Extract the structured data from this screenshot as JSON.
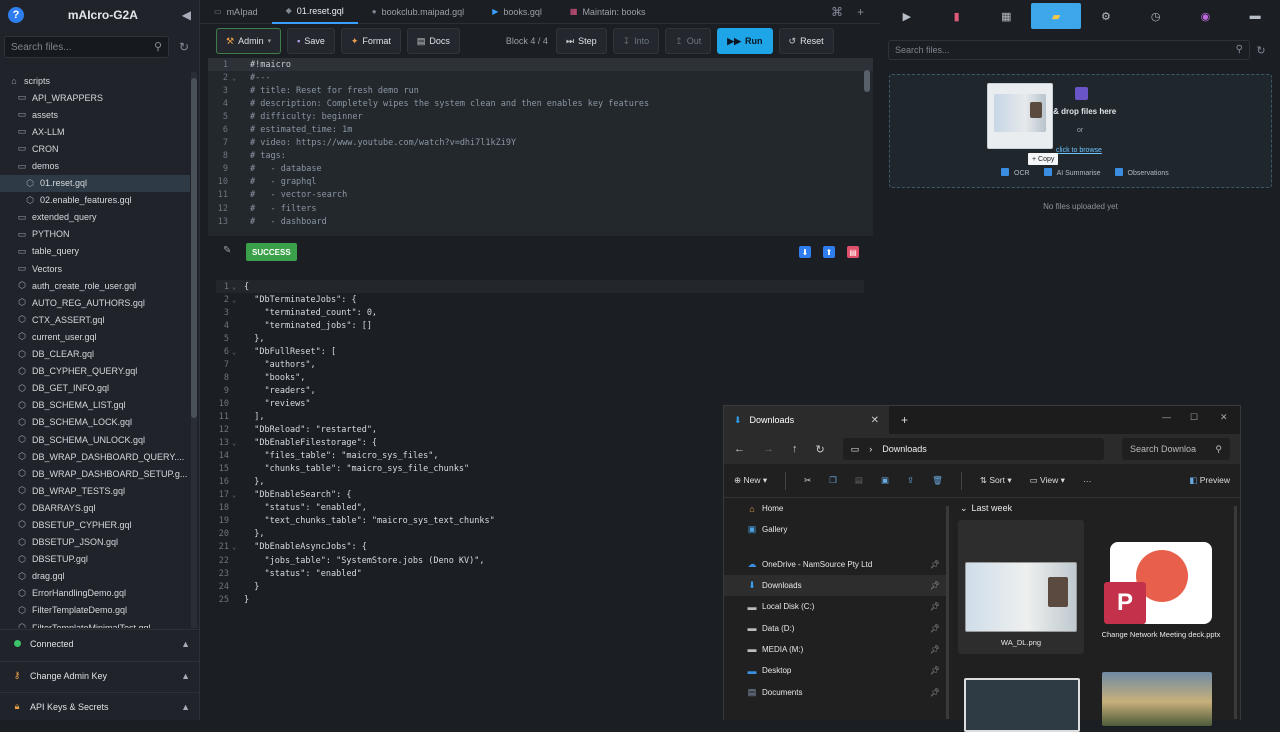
{
  "sidebar": {
    "title": "mAIcro-G2A",
    "search_placeholder": "Search files...",
    "tree": [
      {
        "label": "scripts",
        "icon": "folder",
        "indent": 0
      },
      {
        "label": "API_WRAPPERS",
        "icon": "folder",
        "indent": 1
      },
      {
        "label": "assets",
        "icon": "folder",
        "indent": 1
      },
      {
        "label": "AX-LLM",
        "icon": "folder",
        "indent": 1
      },
      {
        "label": "CRON",
        "icon": "folder",
        "indent": 1
      },
      {
        "label": "demos",
        "icon": "folder",
        "indent": 1
      },
      {
        "label": "01.reset.gql",
        "icon": "graphql",
        "indent": 2,
        "selected": true
      },
      {
        "label": "02.enable_features.gql",
        "icon": "graphql",
        "indent": 2
      },
      {
        "label": "extended_query",
        "icon": "folder",
        "indent": 1
      },
      {
        "label": "PYTHON",
        "icon": "folder",
        "indent": 1
      },
      {
        "label": "table_query",
        "icon": "folder",
        "indent": 1
      },
      {
        "label": "Vectors",
        "icon": "folder",
        "indent": 1
      },
      {
        "label": "auth_create_role_user.gql",
        "icon": "graphql",
        "indent": 1
      },
      {
        "label": "AUTO_REG_AUTHORS.gql",
        "icon": "graphql",
        "indent": 1
      },
      {
        "label": "CTX_ASSERT.gql",
        "icon": "graphql",
        "indent": 1
      },
      {
        "label": "current_user.gql",
        "icon": "graphql",
        "indent": 1
      },
      {
        "label": "DB_CLEAR.gql",
        "icon": "graphql",
        "indent": 1
      },
      {
        "label": "DB_CYPHER_QUERY.gql",
        "icon": "graphql",
        "indent": 1
      },
      {
        "label": "DB_GET_INFO.gql",
        "icon": "graphql",
        "indent": 1
      },
      {
        "label": "DB_SCHEMA_LIST.gql",
        "icon": "graphql",
        "indent": 1
      },
      {
        "label": "DB_SCHEMA_LOCK.gql",
        "icon": "graphql",
        "indent": 1
      },
      {
        "label": "DB_SCHEMA_UNLOCK.gql",
        "icon": "graphql",
        "indent": 1
      },
      {
        "label": "DB_WRAP_DASHBOARD_QUERY....",
        "icon": "graphql",
        "indent": 1
      },
      {
        "label": "DB_WRAP_DASHBOARD_SETUP.g...",
        "icon": "graphql",
        "indent": 1
      },
      {
        "label": "DB_WRAP_TESTS.gql",
        "icon": "graphql",
        "indent": 1
      },
      {
        "label": "DBARRAYS.gql",
        "icon": "graphql",
        "indent": 1
      },
      {
        "label": "DBSETUP_CYPHER.gql",
        "icon": "graphql",
        "indent": 1
      },
      {
        "label": "DBSETUP_JSON.gql",
        "icon": "graphql",
        "indent": 1
      },
      {
        "label": "DBSETUP.gql",
        "icon": "graphql",
        "indent": 1
      },
      {
        "label": "drag.gql",
        "icon": "graphql",
        "indent": 1
      },
      {
        "label": "ErrorHandlingDemo.gql",
        "icon": "graphql",
        "indent": 1
      },
      {
        "label": "FilterTemplateDemo.gql",
        "icon": "graphql",
        "indent": 1
      },
      {
        "label": "FilterTemplateMinimalTest.gql",
        "icon": "graphql",
        "indent": 1
      }
    ],
    "footer": {
      "connected": "Connected",
      "admin_key": "Change Admin Key",
      "api_keys": "API Keys & Secrets"
    }
  },
  "tabs": [
    {
      "label": "mAIpad",
      "icon": "pad"
    },
    {
      "label": "01.reset.gql",
      "icon": "graphql",
      "active": true
    },
    {
      "label": "bookclub.maipad.gql",
      "icon": "dot"
    },
    {
      "label": "books.gql",
      "icon": "play"
    },
    {
      "label": "Maintain: books",
      "icon": "grid"
    }
  ],
  "toolbar": {
    "admin": "Admin",
    "save": "Save",
    "format": "Format",
    "docs": "Docs",
    "block": "Block 4 / 4",
    "step": "Step",
    "into": "Into",
    "out": "Out",
    "run": "Run",
    "reset": "Reset"
  },
  "code_lines": [
    "#!maicro",
    "#---",
    "# title: Reset for fresh demo run",
    "# description: Completely wipes the system clean and then enables key features",
    "# difficulty: beginner",
    "# estimated_time: 1m",
    "# video: https://www.youtube.com/watch?v=dhi7l1kZi9Y",
    "# tags:",
    "#   - database",
    "#   - graphql",
    "#   - vector-search",
    "#   - filters",
    "#   - dashboard"
  ],
  "result": {
    "status": "SUCCESS"
  },
  "json_lines": [
    "{",
    "  \"DbTerminateJobs\": {",
    "    \"terminated_count\": 0,",
    "    \"terminated_jobs\": []",
    "  },",
    "  \"DbFullReset\": [",
    "    \"authors\",",
    "    \"books\",",
    "    \"readers\",",
    "    \"reviews\"",
    "  ],",
    "  \"DbReload\": \"restarted\",",
    "  \"DbEnableFilestorage\": {",
    "    \"files_table\": \"maicro_sys_files\",",
    "    \"chunks_table\": \"maicro_sys_file_chunks\"",
    "  },",
    "  \"DbEnableSearch\": {",
    "    \"status\": \"enabled\",",
    "    \"text_chunks_table\": \"maicro_sys_text_chunks\"",
    "  },",
    "  \"DbEnableAsyncJobs\": {",
    "    \"jobs_table\": \"SystemStore.jobs (Deno KV)\",",
    "    \"status\": \"enabled\"",
    "  }",
    "}"
  ],
  "right_panel": {
    "search_placeholder": "Search files...",
    "drop_text": "g & drop files here",
    "or": "or",
    "browse": "click to browse",
    "copy_tip": "+ Copy",
    "options": [
      "OCR",
      "AI Summarise",
      "Observations"
    ],
    "no_files": "No files uploaded yet"
  },
  "explorer": {
    "tab_title": "Downloads",
    "path": "Downloads",
    "search": "Search Downloa",
    "cmd": {
      "new": "New",
      "sort": "Sort",
      "view": "View",
      "preview": "Preview"
    },
    "nav": [
      {
        "label": "Home",
        "icon": "home"
      },
      {
        "label": "Gallery",
        "icon": "gallery"
      },
      {
        "label": "OneDrive - NamSource Pty Ltd",
        "icon": "cloud",
        "pin": true
      },
      {
        "label": "Downloads",
        "icon": "download",
        "pin": true,
        "selected": true
      },
      {
        "label": "Local Disk (C:)",
        "icon": "drive",
        "pin": true
      },
      {
        "label": "Data (D:)",
        "icon": "drive",
        "pin": true
      },
      {
        "label": "MEDIA (M:)",
        "icon": "drive",
        "pin": true
      },
      {
        "label": "Desktop",
        "icon": "desktop",
        "pin": true
      },
      {
        "label": "Documents",
        "icon": "documents",
        "pin": true
      }
    ],
    "group": "Last week",
    "files": [
      {
        "name": "WA_DL.png"
      },
      {
        "name": "Change Network Meeting deck.pptx"
      }
    ]
  }
}
